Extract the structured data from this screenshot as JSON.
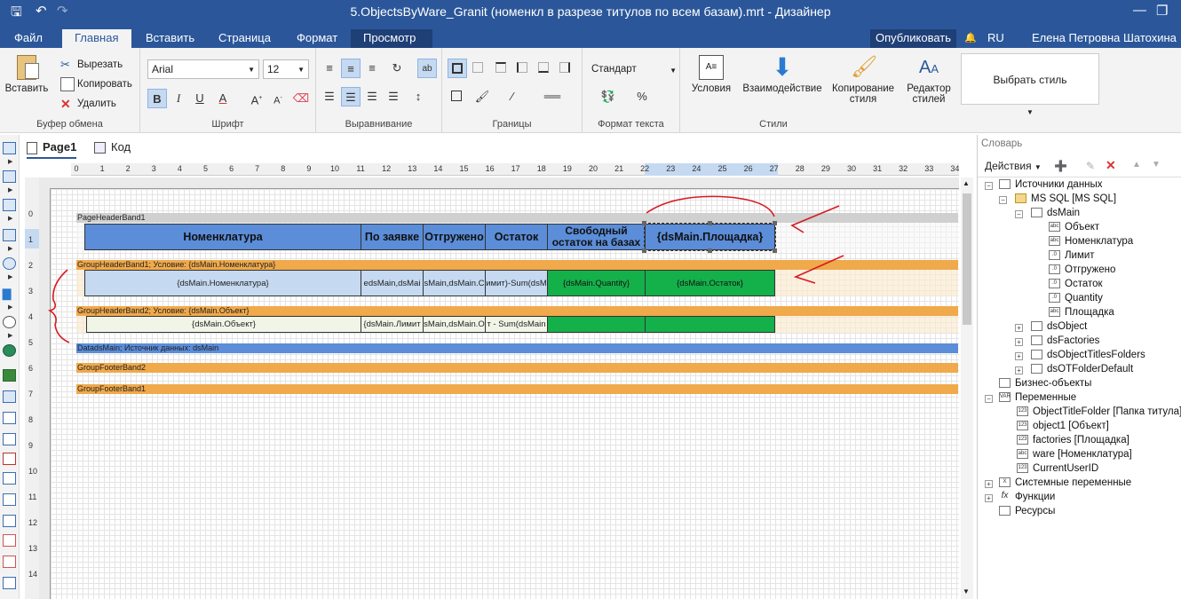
{
  "window": {
    "title": "5.ObjectsByWare_Granit (номенкл в разрезе титулов по всем базам).mrt - Дизайнер"
  },
  "menu": {
    "tabs": [
      "Файл",
      "Главная",
      "Вставить",
      "Страница",
      "Формат",
      "Просмотр"
    ],
    "publish": "Опубликовать",
    "lang": "RU",
    "user": "Елена Петровна Шатохина"
  },
  "ribbon": {
    "clipboard": {
      "paste": "Вставить",
      "cut": "Вырезать",
      "copy": "Копировать",
      "delete": "Удалить",
      "label": "Буфер обмена"
    },
    "font": {
      "family": "Arial",
      "size": "12",
      "label": "Шрифт"
    },
    "align": {
      "label": "Выравнивание"
    },
    "borders": {
      "label": "Границы"
    },
    "textformat": {
      "value": "Стандарт",
      "label": "Формат текста"
    },
    "styles": {
      "conditions": "Условия",
      "interaction": "Взаимодействие",
      "copy_style_1": "Копирование",
      "copy_style_2": "стиля",
      "editor_1": "Редактор",
      "editor_2": "стилей",
      "choose": "Выбрать стиль",
      "label": "Стили"
    }
  },
  "doc": {
    "tab_page": "Page1",
    "tab_code": "Код"
  },
  "ruler": {
    "h": [
      "0",
      "1",
      "2",
      "3",
      "4",
      "5",
      "6",
      "7",
      "8",
      "9",
      "10",
      "11",
      "12",
      "13",
      "14",
      "15",
      "16",
      "17",
      "18",
      "19",
      "20",
      "21",
      "22",
      "23",
      "24",
      "25",
      "26",
      "27",
      "28",
      "29",
      "30",
      "31",
      "32",
      "33",
      "34"
    ],
    "v": [
      "0",
      "1",
      "2",
      "3",
      "4",
      "5",
      "6",
      "7",
      "8",
      "9",
      "10",
      "11",
      "12",
      "13",
      "14"
    ]
  },
  "bands": {
    "pageheader": "PageHeaderBand1",
    "gh1": "GroupHeaderBand1; Условие: {dsMain.Номенклатура}",
    "gh2": "GroupHeaderBand2; Условие: {dsMain.Объект}",
    "data": "DatadsMain; Источник данных: dsMain",
    "gf2": "GroupFooterBand2",
    "gf1": "GroupFooterBand1"
  },
  "cells": {
    "h1": "Номенклатура",
    "h2": "По заявке",
    "h3": "Отгружено",
    "h4": "Остаток",
    "h5a": "Свободный",
    "h5b": "остаток на базах",
    "h6": "{dsMain.Площадка}",
    "g1a": "{dsMain.Номенклатура}",
    "g1b": "edsMain,dsMai",
    "g1c": "sMain,dsMain.C",
    "g1d": "имит)-Sum(dsM",
    "g1e": "{dsMain.Quantity}",
    "g1f": "{dsMain.Остаток}",
    "g2a": "{dsMain.Объект}",
    "g2b": "{dsMain.Лимит",
    "g2c": "sMain,dsMain.O",
    "g2d": "т - Sum(dsMain"
  },
  "dictionary": {
    "title": "Словарь",
    "actions": "Действия",
    "items": [
      "Источники данных",
      "MS SQL [MS SQL]",
      "dsMain",
      "Объект",
      "Номенклатура",
      "Лимит",
      "Отгружено",
      "Остаток",
      "Quantity",
      "Площадка",
      "dsObject",
      "dsFactories",
      "dsObjectTitlesFolders",
      "dsOTFolderDefault",
      "Бизнес-объекты",
      "Переменные",
      "ObjectTitleFolder [Папка титула]",
      "object1 [Объект]",
      "factories [Площадка]",
      "ware [Номенклатура]",
      "CurrentUserID",
      "Системные переменные",
      "Функции",
      "Ресурсы"
    ]
  }
}
